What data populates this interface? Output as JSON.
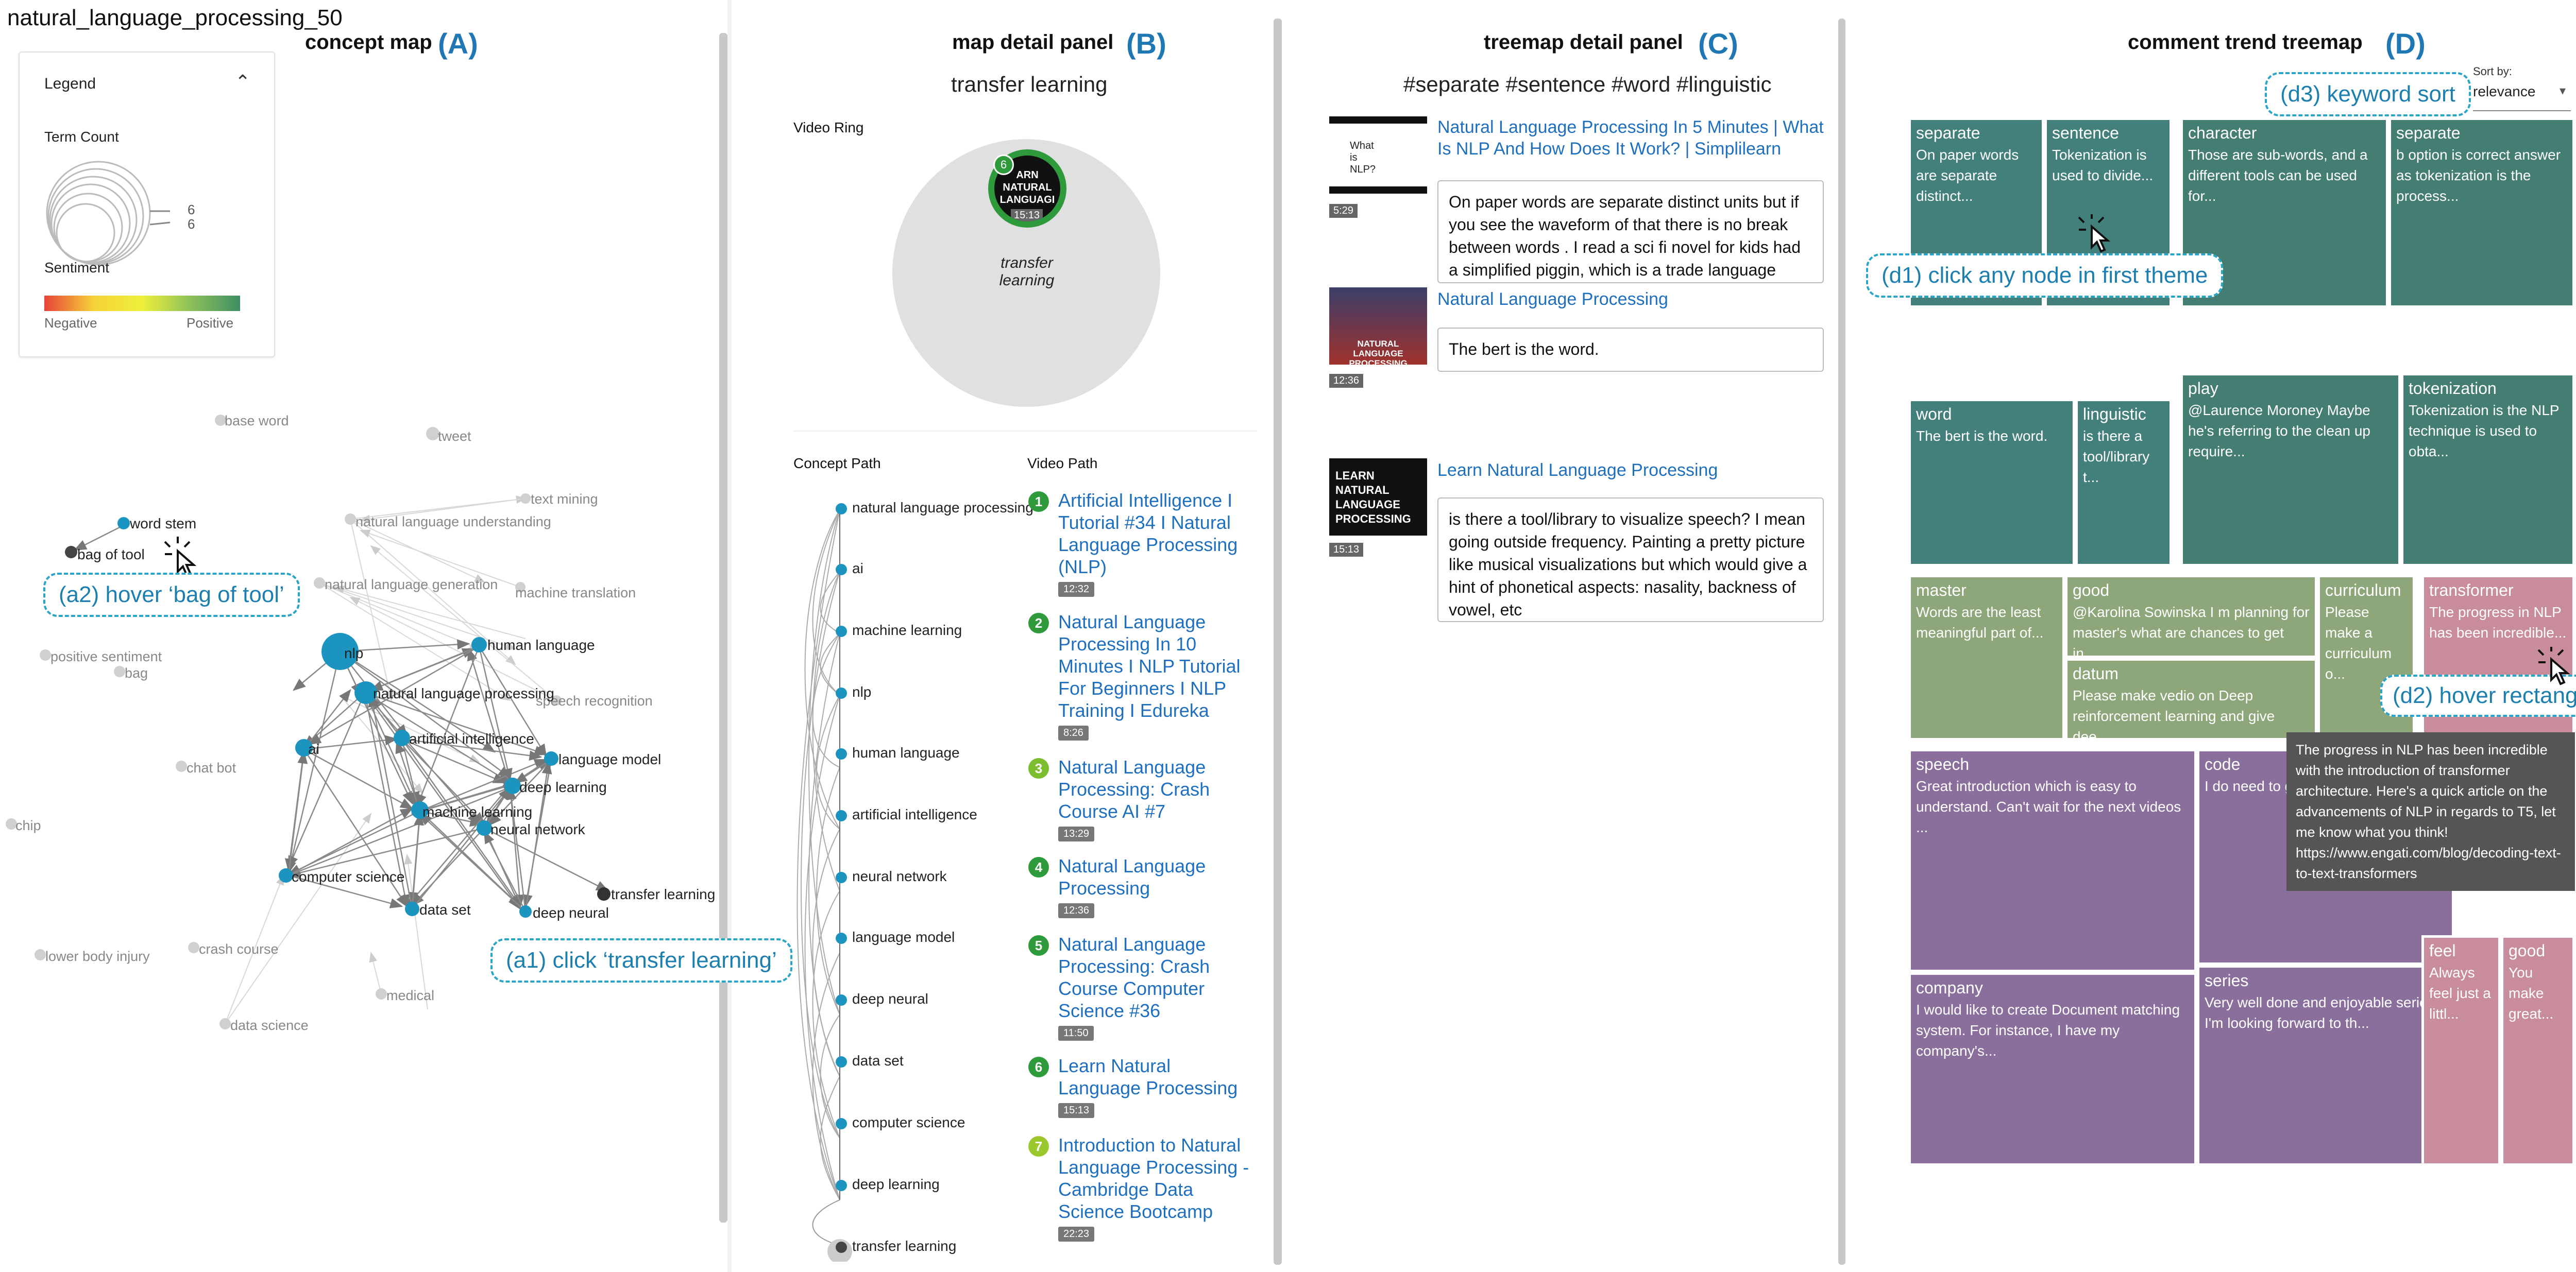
{
  "dataset_id": "natural_language_processing_50",
  "panels": {
    "a": {
      "title": "concept map",
      "label": "(A)"
    },
    "b": {
      "title": "map detail panel",
      "label": "(B)",
      "subtitle": "transfer learning"
    },
    "c": {
      "title": "treemap detail panel",
      "label": "(C)",
      "subtitle": "#separate #sentence #word #linguistic"
    },
    "d": {
      "title": "comment trend treemap",
      "label": "(D)"
    }
  },
  "legend": {
    "title": "Legend",
    "term_count_label": "Term Count",
    "term_count_values": [
      "6",
      "6"
    ],
    "sentiment_label": "Sentiment",
    "negative": "Negative",
    "positive": "Positive",
    "colors": [
      "#e8423a",
      "#f5d237",
      "#eef03a",
      "#8cc05a",
      "#3f8f63"
    ]
  },
  "concept_map": {
    "active_nodes": [
      {
        "label": "word stem"
      },
      {
        "label": "bag of tool"
      },
      {
        "label": "nlp"
      },
      {
        "label": "human language"
      },
      {
        "label": "natural language processing"
      },
      {
        "label": "artificial intelligence"
      },
      {
        "label": "ai"
      },
      {
        "label": "language model"
      },
      {
        "label": "deep learning"
      },
      {
        "label": "machine learning"
      },
      {
        "label": "neural network"
      },
      {
        "label": "computer science"
      },
      {
        "label": "data set"
      },
      {
        "label": "deep neural"
      },
      {
        "label": "transfer learning"
      }
    ],
    "inactive_nodes": [
      {
        "label": "base word"
      },
      {
        "label": "tweet"
      },
      {
        "label": "text mining"
      },
      {
        "label": "natural language understanding"
      },
      {
        "label": "natural language generation"
      },
      {
        "label": "machine translation"
      },
      {
        "label": "positive sentiment"
      },
      {
        "label": "bag"
      },
      {
        "label": "speech recognition"
      },
      {
        "label": "chat bot"
      },
      {
        "label": "chip"
      },
      {
        "label": "lower body injury"
      },
      {
        "label": "crash course"
      },
      {
        "label": "data science"
      },
      {
        "label": "medical"
      }
    ]
  },
  "callouts": {
    "a1": "(a1) click ‘transfer learning’",
    "a2": "(a2) hover ‘bag of tool’",
    "d1": "(d1) click any node in first theme",
    "d2": "(d2) hover rectangle",
    "d3": "(d3) keyword sort"
  },
  "map_detail": {
    "video_ring_label": "Video Ring",
    "ring_center_label": "transfer learning",
    "ring_video": {
      "badge": "6",
      "thumb_text": "ARN NATURAL LANGUAGI",
      "duration": "15:13"
    },
    "concept_path_label": "Concept Path",
    "video_path_label": "Video Path",
    "concept_path": [
      "natural language processing",
      "ai",
      "machine learning",
      "nlp",
      "human language",
      "artificial intelligence",
      "neural network",
      "language model",
      "deep neural",
      "data set",
      "computer science",
      "deep learning",
      "transfer learning"
    ],
    "video_path": [
      {
        "num": "1",
        "title": "Artificial Intelligence I Tutorial #34 I Natural Language Processing (NLP)",
        "duration": "12:32",
        "color": "#2f9a3b"
      },
      {
        "num": "2",
        "title": "Natural Language Processing In 10 Minutes I NLP Tutorial For Beginners I NLP Training I Edureka",
        "duration": "8:26",
        "color": "#2f9a3b"
      },
      {
        "num": "3",
        "title": "Natural Language Processing: Crash Course AI #7",
        "duration": "13:29",
        "color": "#7cbf2e"
      },
      {
        "num": "4",
        "title": "Natural Language Processing",
        "duration": "12:36",
        "color": "#2f9a3b"
      },
      {
        "num": "5",
        "title": "Natural Language Processing: Crash Course Computer Science #36",
        "duration": "11:50",
        "color": "#2f9a3b"
      },
      {
        "num": "6",
        "title": "Learn Natural Language Processing",
        "duration": "15:13",
        "color": "#2f9a3b"
      },
      {
        "num": "7",
        "title": "Introduction to Natural Language Processing - Cambridge Data Science Bootcamp",
        "duration": "22:23",
        "color": "#9bc82c"
      }
    ]
  },
  "treemap_detail": {
    "videos": [
      {
        "title": "Natural Language Processing In 5 Minutes | What Is NLP And How Does It Work? | Simplilearn",
        "duration": "5:29",
        "thumb_text": "What is NLP?",
        "comment": "On paper words are separate distinct units but if you see the waveform of that there is no break between words . I read a sci fi novel for kids had a simplified piggin, which is a trade language used by"
      },
      {
        "title": "Natural Language Processing",
        "duration": "12:36",
        "thumb_text": "NATURAL LANGUAGE PROCESSING",
        "comment": "The bert is the word."
      },
      {
        "title": "Learn Natural Language Processing",
        "duration": "15:13",
        "thumb_text": "LEARN NATURAL LANGUAGE PROCESSING",
        "comment": "is there a tool/library to visualize speech? I mean going outside frequency. Painting a pretty picture like musical visualizations but which would give a hint of phonetical aspects: nasality, backness of vowel, etc"
      }
    ]
  },
  "treemap": {
    "sort_label": "Sort by:",
    "sort_value": "relevance",
    "tooltip": "The progress in NLP has been incredible with the introduction of transformer architecture. Here's a quick article on the advancements of NLP in regards to T5, let me know what you think! https://www.engati.com/blog/decoding-text-to-text-transformers",
    "rects": [
      {
        "keyword": "separate",
        "comment": "On paper words are separate distinct...",
        "color": "#43807c"
      },
      {
        "keyword": "sentence",
        "comment": "Tokenization is used to divide...",
        "color": "#43807c"
      },
      {
        "keyword": "character",
        "comment": "Those are sub-words, and a different tools can be used for...",
        "color": "#447d72"
      },
      {
        "keyword": "separate",
        "comment": "b option is correct answer as tokenization is the process...",
        "color": "#447d72"
      },
      {
        "keyword": "word",
        "comment": "The bert is the word.",
        "color": "#43807c"
      },
      {
        "keyword": "linguistic",
        "comment": "is there a tool/library t...",
        "color": "#43807c"
      },
      {
        "keyword": "play",
        "comment": "@Laurence Moroney Maybe he's referring to the clean up require...",
        "color": "#447d72"
      },
      {
        "keyword": "tokenization",
        "comment": "Tokenization is the NLP technique is used to obta...",
        "color": "#447d72"
      },
      {
        "keyword": "master",
        "comment": "Words are the least meaningful part of...",
        "color": "#8ea77a"
      },
      {
        "keyword": "good",
        "comment": "@Karolina Sowinska I m planning for master's what are chances to get in...",
        "color": "#8ea77a"
      },
      {
        "keyword": "curriculum",
        "comment": "Please make a curriculum o...",
        "color": "#8ea77a"
      },
      {
        "keyword": "datum",
        "comment": "Please make vedio on Deep reinforcement learning and give dee...",
        "color": "#8ea77a"
      },
      {
        "keyword": "transformer",
        "comment": "The progress in NLP has been incredible...",
        "color": "#c98c9b"
      },
      {
        "keyword": "speech",
        "comment": "Great introduction which is easy to understand. Can't wait for the next videos ...",
        "color": "#8a6e9c"
      },
      {
        "keyword": "code",
        "comment": "I do need to g time, thanks fo",
        "color": "#8a6e9c"
      },
      {
        "keyword": "company",
        "comment": "I would like to create Document matching system. For instance, I have my company's...",
        "color": "#8a6e9c"
      },
      {
        "keyword": "series",
        "comment": "Very well done and enjoyable series. I'm looking forward to th...",
        "color": "#8a6e9c"
      },
      {
        "keyword": "feel",
        "comment": "Always feel just a littl...",
        "color": "#c98c9b"
      },
      {
        "keyword": "good",
        "comment": "You make great...",
        "color": "#c98c9b"
      }
    ]
  }
}
